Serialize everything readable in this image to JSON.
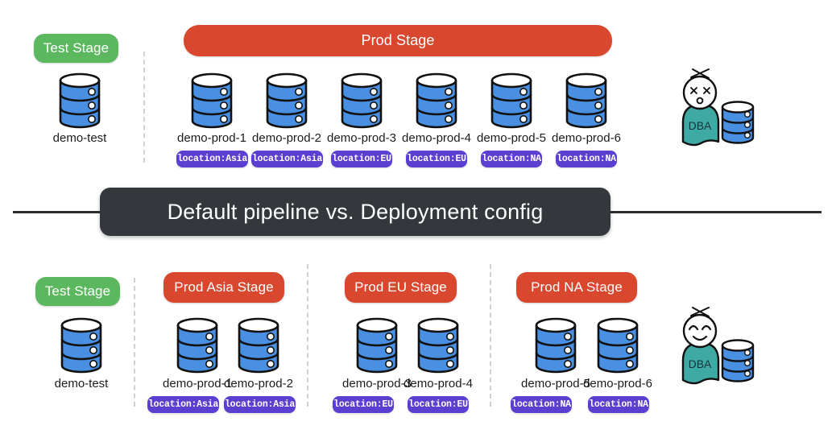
{
  "banner": {
    "text": "Default pipeline vs. Deployment config",
    "color": "#34383c"
  },
  "colors": {
    "test_stage": "#5cb85f",
    "prod_stage": "#d9472f",
    "badge": "#5b3fd0",
    "database": "#4a90e2",
    "dba_body": "#3fa9a3",
    "background": "#ffffff",
    "divider": "#cfcfd4"
  },
  "top": {
    "label": "Default pipeline",
    "stages": [
      {
        "name": "test-stage",
        "label": "Test Stage",
        "color": "green"
      },
      {
        "name": "prod-stage",
        "label": "Prod Stage",
        "color": "red"
      }
    ],
    "nodes": [
      {
        "label": "demo-test",
        "badge": null
      },
      {
        "label": "demo-prod-1",
        "badge": "location:Asia"
      },
      {
        "label": "demo-prod-2",
        "badge": "location:Asia"
      },
      {
        "label": "demo-prod-3",
        "badge": "location:EU"
      },
      {
        "label": "demo-prod-4",
        "badge": "location:EU"
      },
      {
        "label": "demo-prod-5",
        "badge": "location:NA"
      },
      {
        "label": "demo-prod-6",
        "badge": "location:NA"
      }
    ],
    "persona": {
      "label": "DBA",
      "mood": "dead",
      "eyes": "x-eyes",
      "mouth": "o-mouth"
    }
  },
  "bottom": {
    "label": "Deployment config",
    "stages": [
      {
        "name": "test-stage",
        "label": "Test Stage",
        "color": "green"
      },
      {
        "name": "prod-asia-stage",
        "label": "Prod Asia Stage",
        "color": "red"
      },
      {
        "name": "prod-eu-stage",
        "label": "Prod EU Stage",
        "color": "red"
      },
      {
        "name": "prod-na-stage",
        "label": "Prod NA Stage",
        "color": "red"
      }
    ],
    "nodes": [
      {
        "label": "demo-test",
        "badge": null
      },
      {
        "label": "demo-prod-1",
        "badge": "location:Asia"
      },
      {
        "label": "demo-prod-2",
        "badge": "location:Asia"
      },
      {
        "label": "demo-prod-3",
        "badge": "location:EU"
      },
      {
        "label": "demo-prod-4",
        "badge": "location:EU"
      },
      {
        "label": "demo-prod-5",
        "badge": "location:NA"
      },
      {
        "label": "demo-prod-6",
        "badge": "location:NA"
      }
    ],
    "persona": {
      "label": "DBA",
      "mood": "happy",
      "eyes": "smiling-arcs",
      "mouth": "smile"
    }
  }
}
